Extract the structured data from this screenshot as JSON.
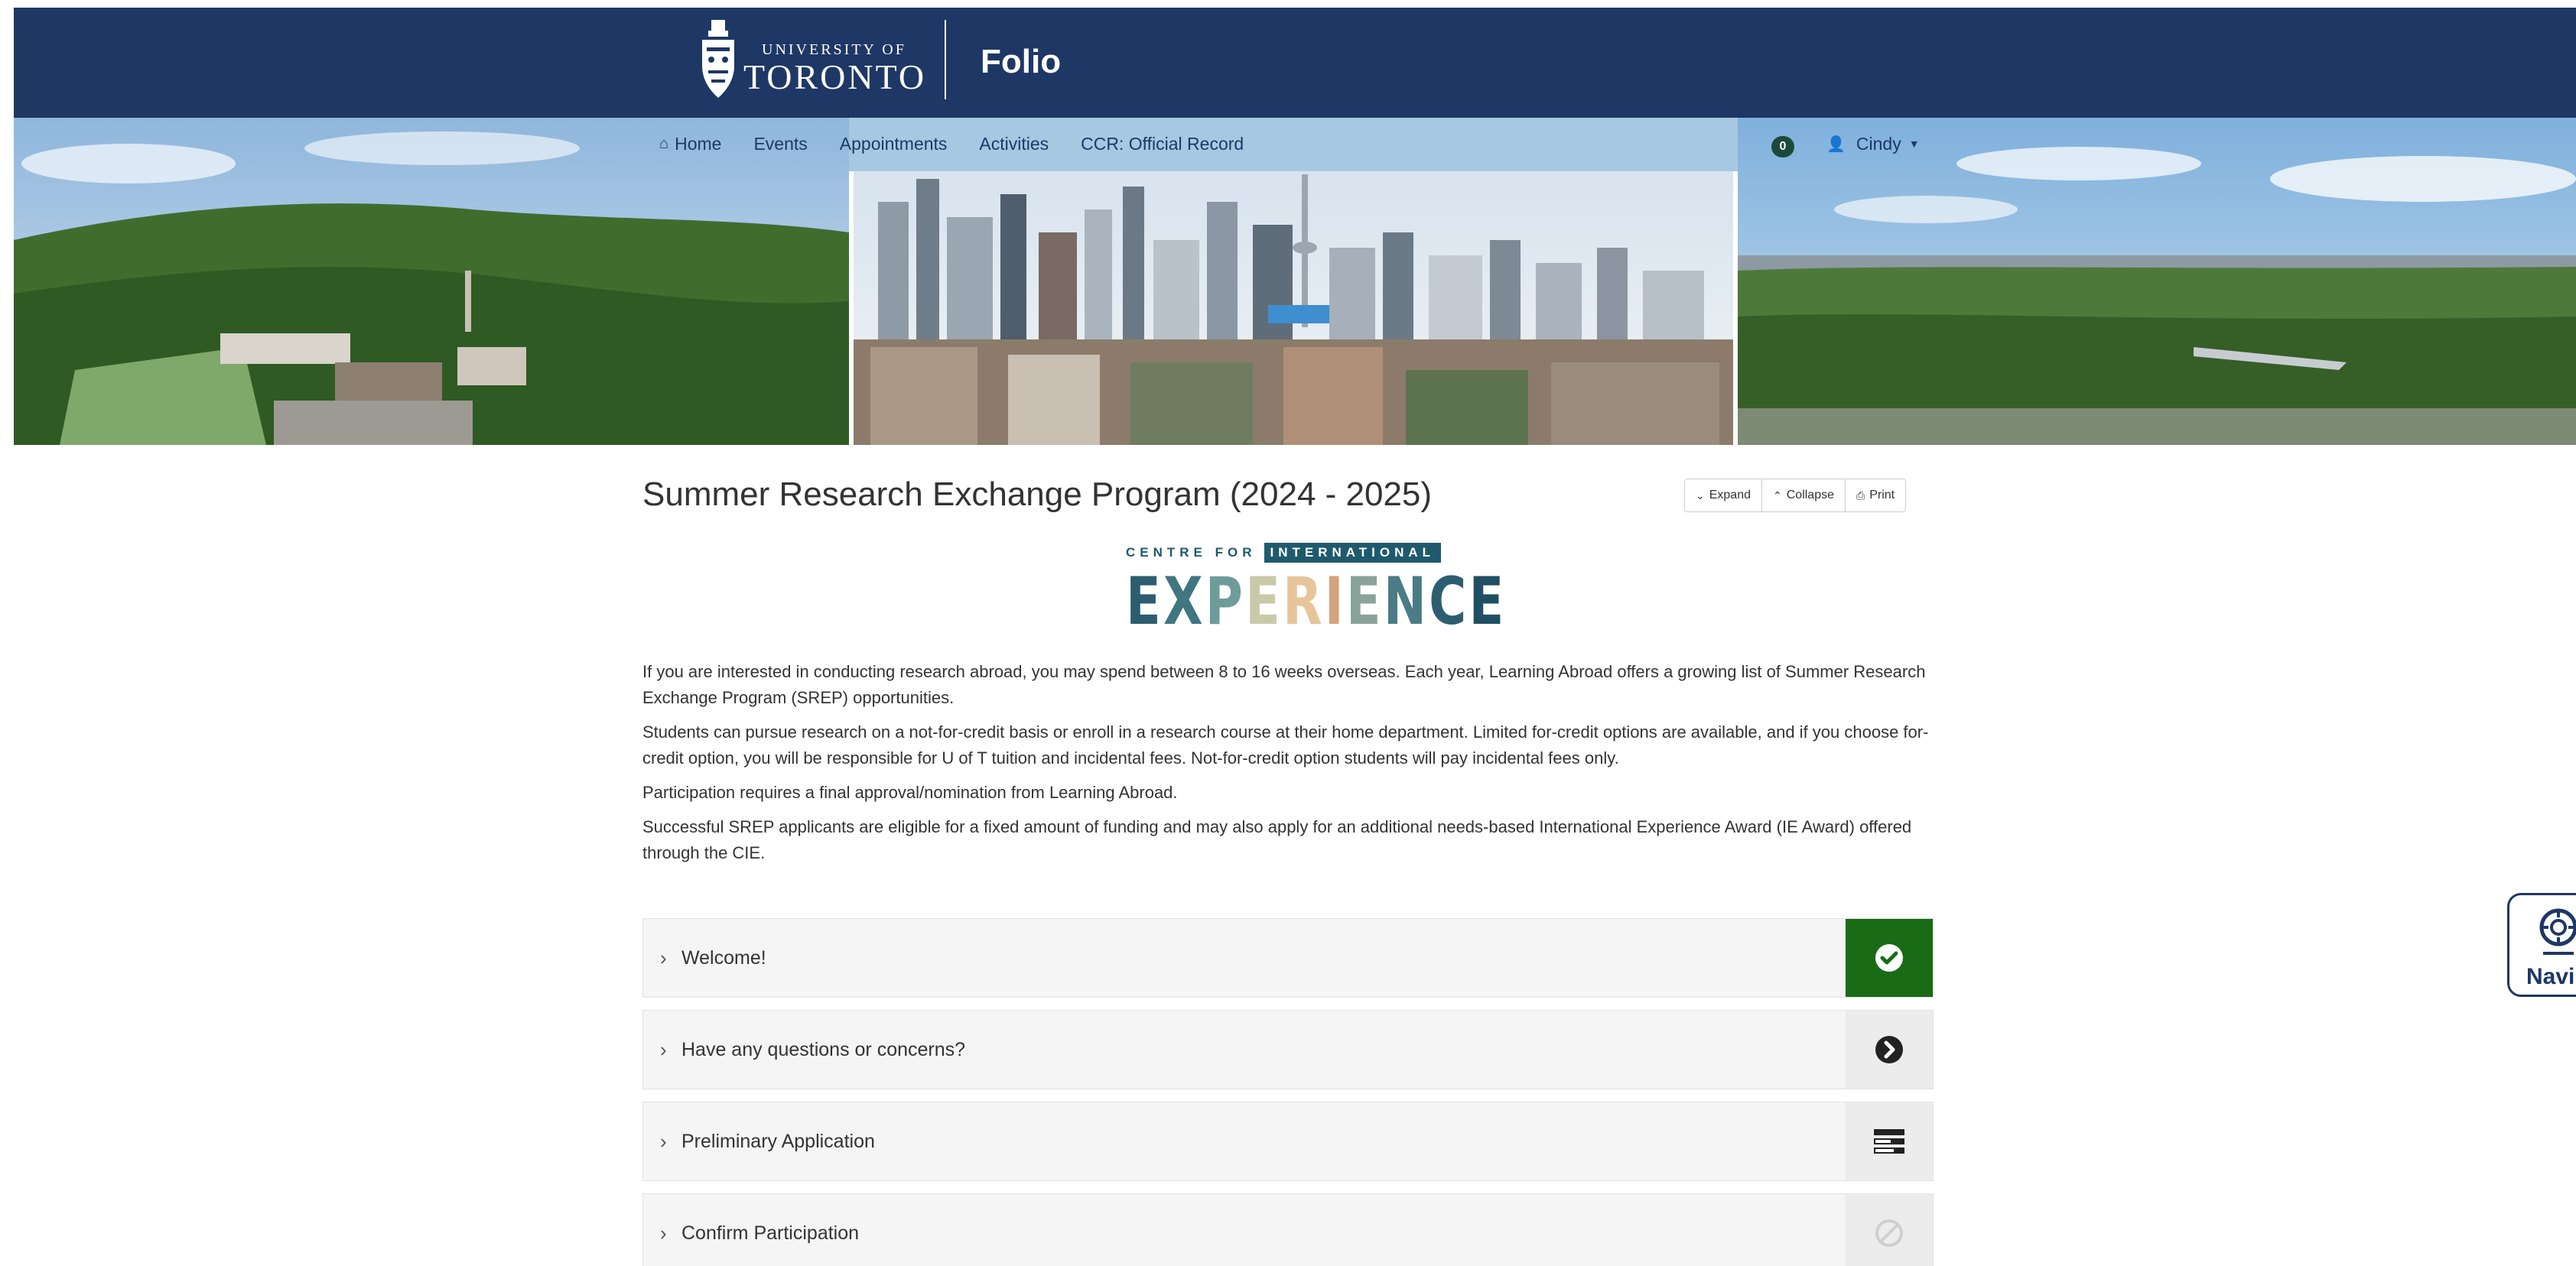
{
  "header": {
    "university_small": "UNIVERSITY OF",
    "university_big": "TORONTO",
    "app_title": "Folio"
  },
  "nav": {
    "items": [
      {
        "label": "Home",
        "icon": "home-icon"
      },
      {
        "label": "Events"
      },
      {
        "label": "Appointments"
      },
      {
        "label": "Activities"
      },
      {
        "label": "CCR: Official Record"
      }
    ],
    "notification_count": "0",
    "user_name": "Cindy"
  },
  "page": {
    "title": "Summer Research Exchange Program (2024 - 2025)",
    "toolbar": {
      "expand": "Expand",
      "collapse": "Collapse",
      "print": "Print"
    },
    "logo": {
      "centre_for": "CENTRE FOR",
      "international": "INTERNATIONAL",
      "experience": "EXPERIENCE",
      "letter_colors": [
        "#2c5d6f",
        "#3f7680",
        "#6e9c9a",
        "#c9c9aa",
        "#e6c59a",
        "#d4a27d",
        "#8aa39a",
        "#4b7b84",
        "#2d5e70",
        "#1f4f62"
      ]
    },
    "paragraphs": [
      "If you are interested in conducting research abroad, you may spend between 8 to 16 weeks overseas. Each year, Learning Abroad offers a growing list of Summer Research Exchange Program (SREP) opportunities.",
      "Students can pursue research on a not-for-credit basis or enroll in a research course at their home department. Limited for-credit options are available, and if you choose for-credit option, you will be responsible for U of T tuition and incidental fees. Not-for-credit option students will pay incidental fees only.",
      "Participation requires a final approval/nomination from Learning Abroad.",
      "Successful SREP applicants are eligible for a fixed amount of funding and may also apply for an additional needs-based International Experience Award (IE Award) offered through the CIE."
    ],
    "sections": [
      {
        "label": "Welcome!",
        "status": "completed",
        "status_icon": "check-circle-icon"
      },
      {
        "label": "Have any questions or concerns?",
        "status": "next",
        "status_icon": "arrow-circle-right-icon"
      },
      {
        "label": "Preliminary Application",
        "status": "form",
        "status_icon": "form-icon"
      },
      {
        "label": "Confirm Participation",
        "status": "locked",
        "status_icon": "ban-icon"
      }
    ]
  },
  "navigator": {
    "label": "Navi"
  },
  "colors": {
    "header_bg": "#1e3765",
    "success": "#1a6b15",
    "nav_text": "#1b3a66"
  }
}
